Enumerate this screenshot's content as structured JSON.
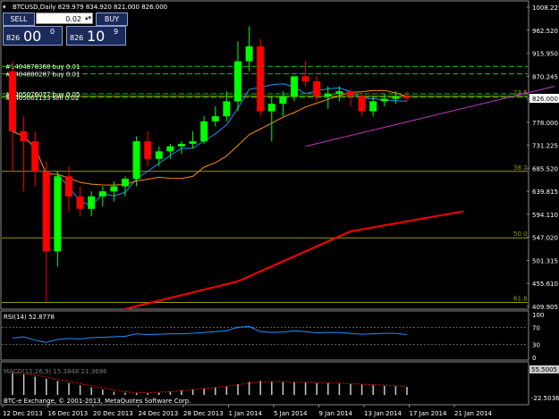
{
  "header": {
    "symbol_line": "BTCUSD,Daily  829.979 834.920 821.000 826.000",
    "menu_arrow": "▾"
  },
  "trade_panel": {
    "sell_label": "SELL",
    "buy_label": "BUY",
    "lot_value": "0.02",
    "sell_price_small": "826",
    "sell_price_big": "00",
    "sell_price_sup": "0",
    "buy_price_small": "826",
    "buy_price_big": "10",
    "buy_price_sup": "9"
  },
  "orders": [
    "#1404878368 buy 0.01",
    "#1404880287 buy 0.01",
    "#1405076077 buy 0.05",
    "#1405061133 sell 0.02"
  ],
  "price_axis": [
    "1008.225",
    "962.520",
    "915.950",
    "870.245",
    "826.000",
    "778.000",
    "731.225",
    "685.520",
    "639.815",
    "594.110",
    "547.020",
    "501.315",
    "455.610",
    "409.905"
  ],
  "current_price": "826.000",
  "fib_labels": [
    "23.6",
    "38.2",
    "50.0",
    "61.8"
  ],
  "rsi": {
    "label": "RSI(14) 52.8778",
    "axis": [
      "100",
      "70",
      "30",
      "0"
    ]
  },
  "macd": {
    "label": "MACD(12,26,9) 15.3848 21.3696",
    "axis_top": "55.5005",
    "axis_bottom": "-22.5036",
    "copyright": "BTC-e Exchange, © 2001-2013, MetaQuotes Software Corp."
  },
  "time_axis": [
    "12 Dec 2013",
    "16 Dec 2013",
    "20 Dec 2013",
    "24 Dec 2013",
    "28 Dec 2013",
    "1 Jan 2014",
    "5 Jan 2014",
    "9 Jan 2014",
    "13 Jan 2014",
    "17 Jan 2014",
    "21 Jan 2014"
  ],
  "colors": {
    "bull": "#00ff00",
    "bear": "#ff0000",
    "ma_fast": "#1e90ff",
    "ma_mid": "#ff8c00",
    "ma_slow": "#ff0000",
    "trend": "#cc33cc",
    "fib": "#999900",
    "order_line": "#00cc00"
  },
  "chart_data": {
    "type": "candlestick",
    "title": "BTCUSD,Daily",
    "ohlc_last": {
      "open": 829.979,
      "high": 834.92,
      "low": 821.0,
      "close": 826.0
    },
    "ylim": [
      409.905,
      1008.225
    ],
    "candles": [
      {
        "o": 880,
        "h": 900,
        "l": 680,
        "c": 760
      },
      {
        "o": 760,
        "h": 790,
        "l": 640,
        "c": 740
      },
      {
        "o": 740,
        "h": 760,
        "l": 650,
        "c": 680
      },
      {
        "o": 680,
        "h": 700,
        "l": 420,
        "c": 520
      },
      {
        "o": 520,
        "h": 680,
        "l": 490,
        "c": 670
      },
      {
        "o": 670,
        "h": 690,
        "l": 600,
        "c": 630
      },
      {
        "o": 630,
        "h": 650,
        "l": 590,
        "c": 605
      },
      {
        "o": 605,
        "h": 640,
        "l": 590,
        "c": 630
      },
      {
        "o": 630,
        "h": 650,
        "l": 610,
        "c": 640
      },
      {
        "o": 640,
        "h": 660,
        "l": 620,
        "c": 650
      },
      {
        "o": 650,
        "h": 670,
        "l": 630,
        "c": 665
      },
      {
        "o": 665,
        "h": 750,
        "l": 650,
        "c": 740
      },
      {
        "o": 740,
        "h": 760,
        "l": 690,
        "c": 705
      },
      {
        "o": 705,
        "h": 730,
        "l": 690,
        "c": 720
      },
      {
        "o": 720,
        "h": 735,
        "l": 705,
        "c": 730
      },
      {
        "o": 730,
        "h": 740,
        "l": 715,
        "c": 735
      },
      {
        "o": 735,
        "h": 760,
        "l": 725,
        "c": 740
      },
      {
        "o": 740,
        "h": 790,
        "l": 735,
        "c": 780
      },
      {
        "o": 780,
        "h": 810,
        "l": 770,
        "c": 790
      },
      {
        "o": 790,
        "h": 840,
        "l": 780,
        "c": 820
      },
      {
        "o": 820,
        "h": 940,
        "l": 800,
        "c": 900
      },
      {
        "o": 900,
        "h": 970,
        "l": 880,
        "c": 930
      },
      {
        "o": 930,
        "h": 945,
        "l": 790,
        "c": 800
      },
      {
        "o": 800,
        "h": 830,
        "l": 740,
        "c": 815
      },
      {
        "o": 815,
        "h": 840,
        "l": 790,
        "c": 830
      },
      {
        "o": 830,
        "h": 860,
        "l": 820,
        "c": 870
      },
      {
        "o": 870,
        "h": 900,
        "l": 850,
        "c": 860
      },
      {
        "o": 860,
        "h": 870,
        "l": 820,
        "c": 830
      },
      {
        "o": 830,
        "h": 850,
        "l": 805,
        "c": 835
      },
      {
        "o": 835,
        "h": 850,
        "l": 820,
        "c": 840
      },
      {
        "o": 840,
        "h": 845,
        "l": 810,
        "c": 830
      },
      {
        "o": 830,
        "h": 840,
        "l": 790,
        "c": 800
      },
      {
        "o": 800,
        "h": 830,
        "l": 790,
        "c": 820
      },
      {
        "o": 820,
        "h": 835,
        "l": 810,
        "c": 825
      },
      {
        "o": 825,
        "h": 840,
        "l": 815,
        "c": 830
      },
      {
        "o": 830,
        "h": 840,
        "l": 820,
        "c": 826
      }
    ],
    "rsi_values": [
      45,
      48,
      40,
      35,
      42,
      44,
      43,
      46,
      47,
      48,
      49,
      55,
      53,
      54,
      55,
      55,
      56,
      58,
      60,
      62,
      70,
      72,
      60,
      58,
      59,
      62,
      60,
      57,
      58,
      58,
      56,
      54,
      55,
      56,
      56,
      53
    ],
    "macd_histogram": [
      40,
      38,
      34,
      30,
      26,
      22,
      18,
      14,
      10,
      6,
      4,
      3,
      3,
      4,
      6,
      8,
      10,
      12,
      14,
      16,
      20,
      24,
      26,
      25,
      24,
      24,
      23,
      22,
      22,
      21,
      20,
      19,
      18,
      17,
      16,
      15
    ],
    "macd_signal": [
      42,
      40,
      37,
      33,
      29,
      25,
      21,
      17,
      13,
      9,
      6,
      4,
      4,
      5,
      6,
      8,
      10,
      12,
      14,
      16,
      19,
      22,
      24,
      25,
      25,
      24,
      24,
      23,
      22,
      22,
      21,
      20,
      19,
      18,
      17,
      16
    ]
  }
}
